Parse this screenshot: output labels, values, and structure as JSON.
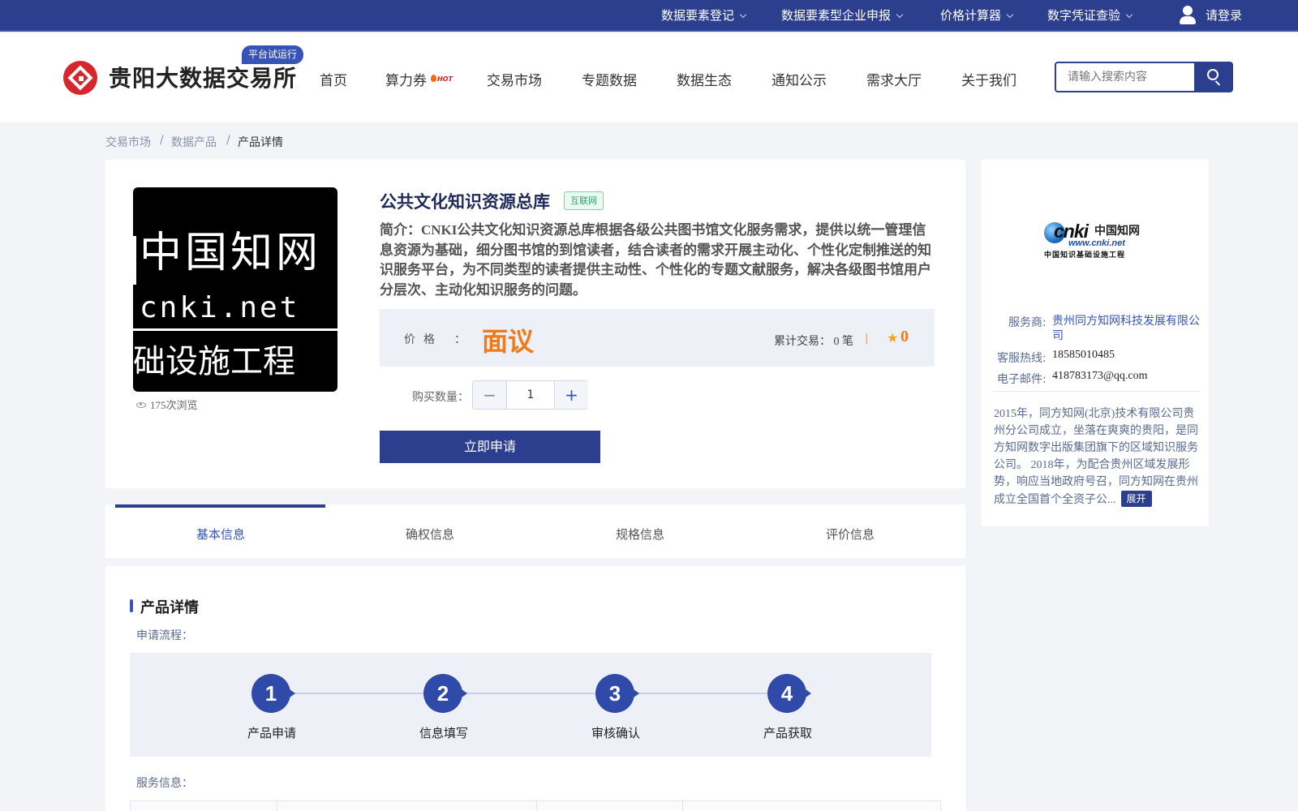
{
  "topbar": {
    "items": [
      "数据要素登记",
      "数据要素型企业申报",
      "价格计算器",
      "数字凭证查验"
    ],
    "login_label": "请登录"
  },
  "header": {
    "site_title": "贵阳大数据交易所",
    "trial_badge": "平台试运行",
    "nav": [
      "首页",
      "算力券",
      "交易市场",
      "专题数据",
      "数据生态",
      "通知公示",
      "需求大厅",
      "关于我们"
    ],
    "hot_badge": "HOT",
    "search_placeholder": "请输入搜索内容"
  },
  "breadcrumb": [
    "交易市场",
    "数据产品",
    "产品详情"
  ],
  "breadcrumb_sep": "/",
  "product": {
    "image_text": {
      "line1": "中国知网",
      "line2": "cnki.net",
      "line3": "础设施工程"
    },
    "views": "175次浏览",
    "title": "公共文化知识资源总库",
    "tag": "互联网",
    "intro": "简介：CNKI公共文化知识资源总库根据各级公共图书馆文化服务需求，提供以统一管理信息资源为基础，细分图书馆的到馆读者，结合读者的需求开展主动化、个性化定制推送的知识服务平台，为不同类型的读者提供主动性、个性化的专题文献服务，解决各级图书馆用户分层次、主动化知识服务的问题。",
    "price_label": "价格",
    "price_colon": "：",
    "price_value": "面议",
    "deals": "累计交易：  0 笔",
    "deals_sep": "|",
    "score": "0",
    "qty_label": "购买数量：",
    "qty_value": "1",
    "apply_label": "立即申请",
    "accent_color": "#ee7a1a",
    "brand_color": "#2c3f8f"
  },
  "provider": {
    "logo": {
      "word": "cnki",
      "cn": "中国知网",
      "url": "www.cnki.net",
      "sub": "中国知识基础设施工程"
    },
    "service_label": "服务商:",
    "service_value": "贵州同方知网科技发展有限公司",
    "hotline_label": "客服热线:",
    "hotline_value": "18585010485",
    "email_label": "电子邮件:",
    "email_value": "418783173@qq.com",
    "description": "2015年，同方知网(北京)技术有限公司贵州分公司成立，坐落在爽爽的贵阳，是同方知网数字出版集团旗下的区域知识服务公司。 2018年，为配合贵州区域发展形势，响应当地政府号召，同方知网在贵州成立全国首个全资子公...",
    "expand_label": "展开"
  },
  "tabs": [
    "基本信息",
    "确权信息",
    "规格信息",
    "评价信息"
  ],
  "details": {
    "section_title": "产品详情",
    "flow_label": "申请流程：",
    "steps": [
      {
        "num": "1",
        "label": "产品申请"
      },
      {
        "num": "2",
        "label": "信息填写"
      },
      {
        "num": "3",
        "label": "审核确认"
      },
      {
        "num": "4",
        "label": "产品获取"
      }
    ],
    "service_info_label": "服务信息："
  }
}
